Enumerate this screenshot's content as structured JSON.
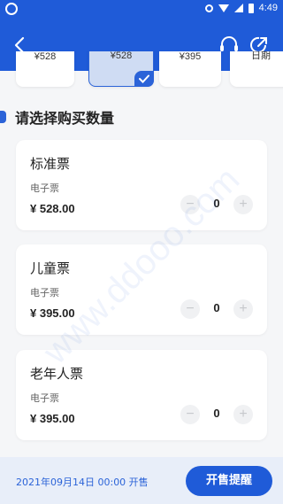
{
  "statusbar": {
    "time": "4:49"
  },
  "topbar": {
    "back_icon": "chevron-left-icon",
    "headset_icon": "headset-icon",
    "share_icon": "share-icon"
  },
  "date_strip": {
    "chips": [
      {
        "label": "¥528",
        "selected": false
      },
      {
        "label": "¥528",
        "selected": true
      },
      {
        "label": "¥395",
        "selected": false
      },
      {
        "label": "日期",
        "selected": false
      }
    ]
  },
  "section": {
    "title": "请选择购买数量"
  },
  "tickets": [
    {
      "name": "标准票",
      "type": "电子票",
      "price": "¥ 528.00",
      "minus": "−",
      "quantity": "0",
      "plus": "+"
    },
    {
      "name": "儿童票",
      "type": "电子票",
      "price": "¥ 395.00",
      "minus": "−",
      "quantity": "0",
      "plus": "+"
    },
    {
      "name": "老年人票",
      "type": "电子票",
      "price": "¥ 395.00",
      "minus": "−",
      "quantity": "0",
      "plus": "+"
    }
  ],
  "watermark": "www.ddooo.com",
  "bottom": {
    "sale_time": "2021年09月14日 00:00 开售",
    "remind_label": "开售提醒"
  },
  "colors": {
    "brand": "#1f5bd8",
    "accent": "#2b63d8"
  }
}
